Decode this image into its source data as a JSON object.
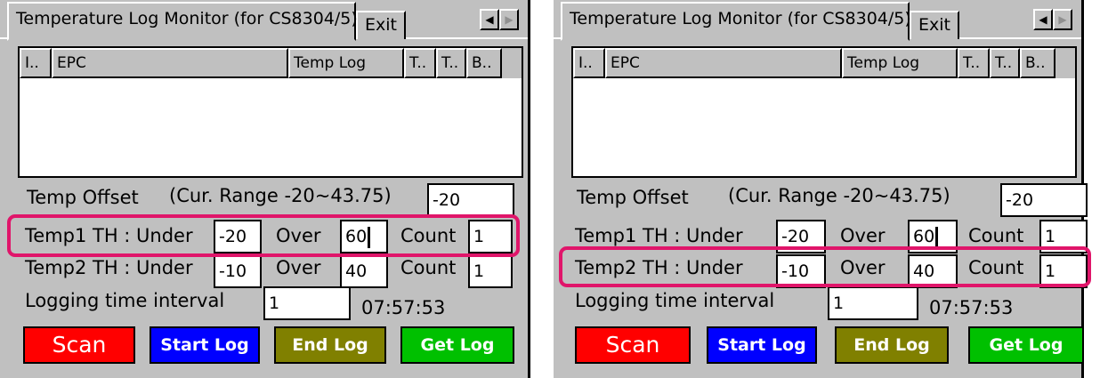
{
  "panels": [
    {
      "tabs": [
        "Temperature Log Monitor (for CS8304/5)",
        "Exit"
      ],
      "columns": [
        "I..",
        "EPC",
        "Temp Log",
        "T..",
        "T..",
        "B.."
      ],
      "temp_offset": {
        "label": "Temp Offset",
        "range": "(Cur. Range -20~43.75)",
        "value": "-20"
      },
      "temp1": {
        "label": "Temp1 TH : Under",
        "under": "-20",
        "over_label": "Over",
        "over": "60",
        "count_label": "Count",
        "count": "1"
      },
      "temp2": {
        "label": "Temp2 TH : Under",
        "under": "-10",
        "over_label": "Over",
        "over": "40",
        "count_label": "Count",
        "count": "1"
      },
      "logging": {
        "label": "Logging time interval",
        "value": "1",
        "time": "07:57:53"
      },
      "buttons": [
        "Scan",
        "Start Log",
        "End Log",
        "Get Log"
      ],
      "highlighted_row": "temp1"
    },
    {
      "tabs": [
        "Temperature Log Monitor (for CS8304/5)",
        "Exit"
      ],
      "columns": [
        "I..",
        "EPC",
        "Temp Log",
        "T..",
        "T..",
        "B.."
      ],
      "temp_offset": {
        "label": "Temp Offset",
        "range": "(Cur. Range -20~43.75)",
        "value": "-20"
      },
      "temp1": {
        "label": "Temp1 TH : Under",
        "under": "-20",
        "over_label": "Over",
        "over": "60",
        "count_label": "Count",
        "count": "1"
      },
      "temp2": {
        "label": "Temp2 TH : Under",
        "under": "-10",
        "over_label": "Over",
        "over": "40",
        "count_label": "Count",
        "count": "1"
      },
      "logging": {
        "label": "Logging time interval",
        "value": "1",
        "time": "07:57:53"
      },
      "buttons": [
        "Scan",
        "Start Log",
        "End Log",
        "Get Log"
      ],
      "highlighted_row": "temp2"
    }
  ],
  "colors": {
    "scan": "#ff0000",
    "start_log": "#0000ff",
    "end_log": "#808000",
    "get_log": "#00c000",
    "highlight": "#e0156a",
    "window_bg": "#c0c0c0"
  },
  "icons": {
    "tab_scroll_left": "left-arrow-icon",
    "tab_scroll_right": "right-arrow-icon"
  }
}
